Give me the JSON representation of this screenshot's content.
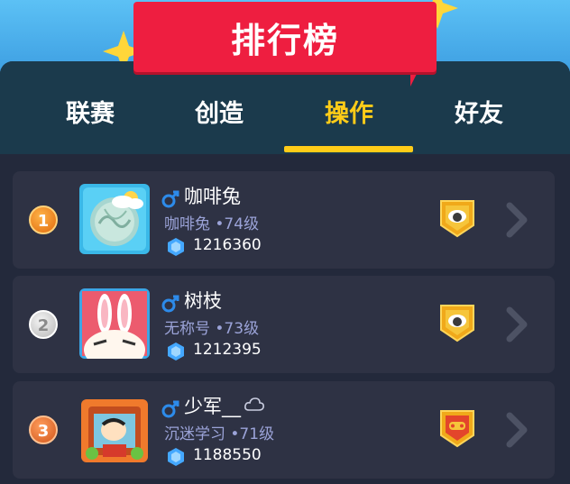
{
  "header": {
    "title": "排行榜"
  },
  "tabs": [
    {
      "label": "联赛",
      "active": false
    },
    {
      "label": "创造",
      "active": false
    },
    {
      "label": "操作",
      "active": true
    },
    {
      "label": "好友",
      "active": false
    }
  ],
  "colors": {
    "accent": "#ffcc18",
    "banner": "#ee1e40",
    "row_bg": "#2e3244",
    "panel_bg": "#23293b",
    "subtext": "#9ba3d8"
  },
  "leaderboard": [
    {
      "rank": "1",
      "name": "咖啡兔",
      "subtitle": "咖啡兔 •74级",
      "score": "1216360",
      "gender_icon": "male-icon",
      "badge_icon": "sheep-badge-icon"
    },
    {
      "rank": "2",
      "name": "树枝",
      "subtitle": "无称号 •73级",
      "score": "1212395",
      "gender_icon": "male-icon",
      "badge_icon": "sheep-badge-icon"
    },
    {
      "rank": "3",
      "name": "少军__",
      "subtitle": "沉迷学习 •71级",
      "score": "1188550",
      "gender_icon": "male-icon",
      "badge_icon": "gamepad-badge-icon"
    }
  ]
}
